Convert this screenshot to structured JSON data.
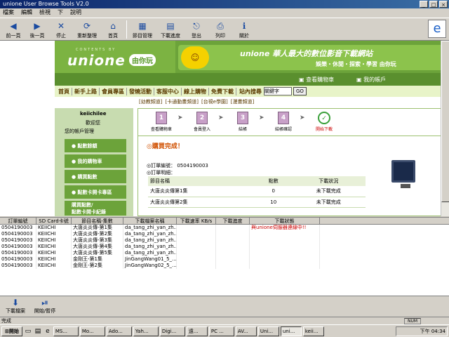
{
  "window": {
    "title": "unione User Browse Tools V2.0"
  },
  "menu": [
    "檔案",
    "編輯",
    "檢視",
    "下",
    "說明"
  ],
  "toolbar": [
    {
      "label": "前一頁",
      "icon": "back-arrow-icon",
      "glyph": "◀"
    },
    {
      "label": "後一頁",
      "icon": "forward-arrow-icon",
      "glyph": "▶"
    },
    {
      "label": "停止",
      "icon": "stop-icon",
      "glyph": "✕"
    },
    {
      "label": "重新整理",
      "icon": "refresh-icon",
      "glyph": "⟳"
    },
    {
      "label": "首頁",
      "icon": "home-icon",
      "glyph": "⌂"
    },
    {
      "label": "節目管理",
      "icon": "program-icon",
      "glyph": "▦"
    },
    {
      "label": "下載進度",
      "icon": "download-progress-icon",
      "glyph": "▤"
    },
    {
      "label": "登出",
      "icon": "logout-icon",
      "glyph": "⎋"
    },
    {
      "label": "列印",
      "icon": "print-icon",
      "glyph": "⎙"
    },
    {
      "label": "關於",
      "icon": "about-icon",
      "glyph": "ℹ"
    }
  ],
  "site": {
    "logo_small": "CONTENTS BY",
    "logo_main": "unione",
    "logo_cn": "由你玩",
    "slogan": "unione 華人最大的數位影音下載網站",
    "subslogan": "娛樂・休閒・探索・學習 由你玩",
    "cart_link": "查看購物車",
    "account_link": "我的帳戶",
    "nav": [
      "首頁",
      "新手上路",
      "會員專區",
      "發燒活動",
      "客服中心",
      "線上購物",
      "免費下載"
    ],
    "search_label": "站內搜尋",
    "search_value": "關鍵字",
    "go_label": "GO",
    "sublinks": [
      "[幼教頻道]",
      "[卡通動畫頻道]",
      "[台視e學園]",
      "[漫畫頻道]"
    ]
  },
  "sidebar": {
    "username": "keiichilee",
    "welcome": "歡迎您",
    "account_mgmt": "您的帳戶管理",
    "items": [
      "點數餘額",
      "我的購物車",
      "購買點數",
      "點數卡開卡專區",
      "購買點數/\n點數卡開卡紀錄"
    ]
  },
  "steps": [
    "查看購物車",
    "會員登入",
    "結帳",
    "結帳確認",
    "開始下載"
  ],
  "purchase": {
    "title": "購買完成！",
    "order_no": "訂單編號： 0504190003",
    "order_detail": "訂單明細：",
    "headers": [
      "節目名稱",
      "點數",
      "下載狀況"
    ],
    "rows": [
      [
        "大唐炎炎傳第1集",
        "0",
        "未下載完成"
      ],
      [
        "大唐炎炎傳第2集",
        "10",
        "未下載完成"
      ]
    ]
  },
  "queue": {
    "headers": [
      "訂單編號",
      "SD Card卡號",
      "節目名稱-集數",
      "下載檔案名稱",
      "下載速率 KB/s",
      "下載進度",
      "下載狀態"
    ],
    "rows": [
      [
        "0504190003",
        "KEIICHI",
        "大唐炎炎傳-第1集",
        "da_tang_zhi_yan_zh...",
        "",
        "",
        "與unione伺服器連線中!!"
      ],
      [
        "0504190003",
        "KEIICHI",
        "大唐炎炎傳-第2集",
        "da_tang_zhi_yan_zh...",
        "",
        "",
        ""
      ],
      [
        "0504190003",
        "KEIICHI",
        "大唐炎炎傳-第3集",
        "da_tang_zhi_yan_zh...",
        "",
        "",
        ""
      ],
      [
        "0504190003",
        "KEIICHI",
        "大唐炎炎傳-第4集",
        "da_tang_zhi_yan_zh...",
        "",
        "",
        ""
      ],
      [
        "0504190003",
        "KEIICHI",
        "大唐炎炎傳-第5集",
        "da_tang_zhi_yan_zh...",
        "",
        "",
        ""
      ],
      [
        "0504190003",
        "KEIICHI",
        "金剛王-第1集",
        "JinGangWang01_5_...",
        "",
        "",
        ""
      ],
      [
        "0504190003",
        "KEIICHI",
        "金剛王-第2集",
        "JinGangWang02_5_...",
        "",
        "",
        ""
      ]
    ]
  },
  "bottom_tools": [
    {
      "label": "下載檔案",
      "icon": "download-file-icon"
    },
    {
      "label": "開始/暫停",
      "icon": "start-pause-icon"
    }
  ],
  "statusbar": {
    "text": "完成",
    "numlock": "NUM"
  },
  "taskbar": {
    "start": "開始",
    "tasks": [
      "MS...",
      "Mo...",
      "Ado...",
      "Yah...",
      "Digi...",
      "遠...",
      "PC ...",
      "AV...",
      "Uni...",
      "uni...",
      "keii..."
    ],
    "clock": "下午 04:34"
  }
}
